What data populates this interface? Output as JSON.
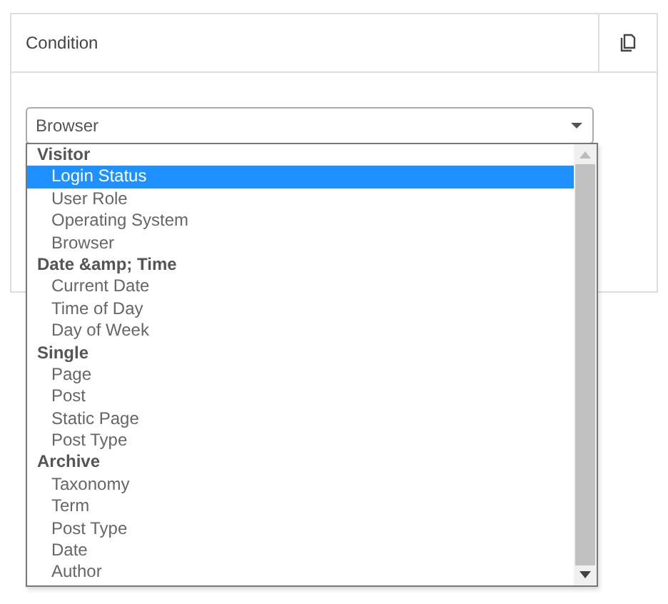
{
  "panel": {
    "title": "Condition"
  },
  "select": {
    "value": "Browser"
  },
  "dropdown": {
    "groups": [
      {
        "label": "Visitor",
        "children": [
          {
            "label": "Login Status",
            "selected": true
          },
          {
            "label": "User Role",
            "selected": false
          },
          {
            "label": "Operating System",
            "selected": false
          },
          {
            "label": "Browser",
            "selected": false
          }
        ]
      },
      {
        "label": "Date &amp; Time",
        "children": [
          {
            "label": "Current Date",
            "selected": false
          },
          {
            "label": "Time of Day",
            "selected": false
          },
          {
            "label": "Day of Week",
            "selected": false
          }
        ]
      },
      {
        "label": "Single",
        "children": [
          {
            "label": "Page",
            "selected": false
          },
          {
            "label": "Post",
            "selected": false
          },
          {
            "label": "Static Page",
            "selected": false
          },
          {
            "label": "Post Type",
            "selected": false
          }
        ]
      },
      {
        "label": "Archive",
        "children": [
          {
            "label": "Taxonomy",
            "selected": false
          },
          {
            "label": "Term",
            "selected": false
          },
          {
            "label": "Post Type",
            "selected": false
          },
          {
            "label": "Date",
            "selected": false
          },
          {
            "label": "Author",
            "selected": false
          }
        ]
      }
    ]
  }
}
